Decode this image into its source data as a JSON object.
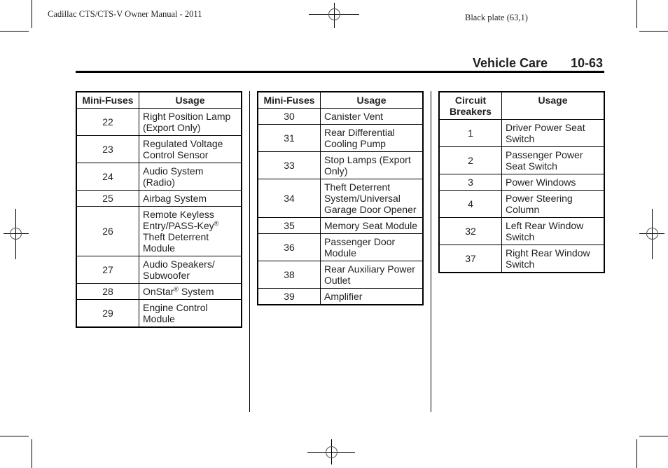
{
  "running_head": {
    "left": "Cadillac CTS/CTS-V Owner Manual - 2011",
    "right": "Black plate (63,1)"
  },
  "section": {
    "title": "Vehicle Care",
    "page_number": "10-63"
  },
  "table1": {
    "headers": [
      "Mini-Fuses",
      "Usage"
    ],
    "rows": [
      {
        "number": "22",
        "usage": "Right Position Lamp (Export Only)"
      },
      {
        "number": "23",
        "usage": "Regulated Voltage Control Sensor"
      },
      {
        "number": "24",
        "usage": "Audio System (Radio)"
      },
      {
        "number": "25",
        "usage": "Airbag System"
      },
      {
        "number": "26",
        "usage_pre": "Remote Keyless Entry/PASS-Key",
        "usage_sup": "®",
        "usage_post": " Theft Deterrent Module"
      },
      {
        "number": "27",
        "usage": "Audio Speakers/ Subwoofer"
      },
      {
        "number": "28",
        "usage_pre": "OnStar",
        "usage_sup": "®",
        "usage_post": " System"
      },
      {
        "number": "29",
        "usage": "Engine Control Module"
      }
    ]
  },
  "table2": {
    "headers": [
      "Mini-Fuses",
      "Usage"
    ],
    "rows": [
      {
        "number": "30",
        "usage": "Canister Vent"
      },
      {
        "number": "31",
        "usage": "Rear Differential Cooling Pump"
      },
      {
        "number": "33",
        "usage": "Stop Lamps (Export Only)"
      },
      {
        "number": "34",
        "usage": "Theft Deterrent System/Universal Garage Door Opener"
      },
      {
        "number": "35",
        "usage": "Memory Seat Module"
      },
      {
        "number": "36",
        "usage": "Passenger Door Module"
      },
      {
        "number": "38",
        "usage": "Rear Auxiliary Power Outlet"
      },
      {
        "number": "39",
        "usage": "Amplifier"
      }
    ]
  },
  "table3": {
    "headers": [
      "Circuit Breakers",
      "Usage"
    ],
    "rows": [
      {
        "number": "1",
        "usage": "Driver Power Seat Switch"
      },
      {
        "number": "2",
        "usage": "Passenger Power Seat Switch"
      },
      {
        "number": "3",
        "usage": "Power Windows"
      },
      {
        "number": "4",
        "usage": "Power Steering Column"
      },
      {
        "number": "32",
        "usage": "Left Rear Window Switch"
      },
      {
        "number": "37",
        "usage": "Right Rear Window Switch"
      }
    ]
  },
  "icons": {
    "crop_marks": "crop-mark-icon",
    "registration": "registration-target-icon"
  }
}
